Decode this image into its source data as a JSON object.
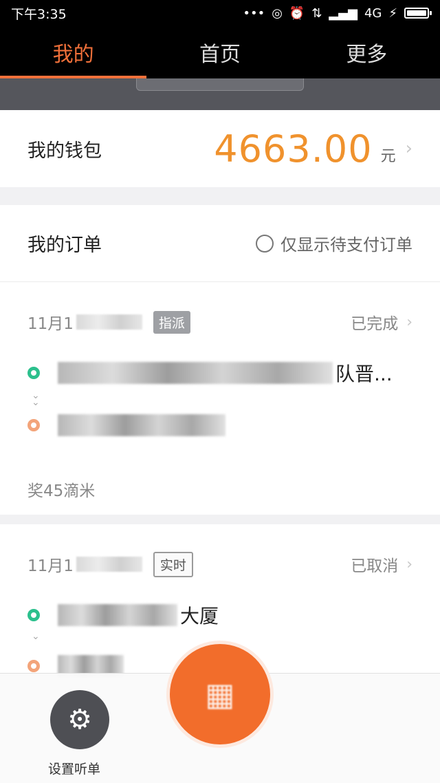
{
  "status_bar": {
    "time": "下午3:35",
    "network": "4G"
  },
  "tabs": [
    {
      "label": "我的",
      "active": true
    },
    {
      "label": "首页",
      "active": false
    },
    {
      "label": "更多",
      "active": false
    }
  ],
  "wallet": {
    "label": "我的钱包",
    "amount": "4663.00",
    "unit": "元"
  },
  "orders": {
    "title": "我的订单",
    "filter_label": "仅显示待支付订单",
    "items": [
      {
        "date_prefix": "11月1",
        "tag": "指派",
        "status": "已完成",
        "start_tail": "队晋...",
        "reward": "奖45滴米"
      },
      {
        "date_prefix": "11月1",
        "tag": "实时",
        "status": "已取消",
        "start_tail": "大厦"
      }
    ]
  },
  "bottom": {
    "settings_label": "设置听单"
  },
  "colors": {
    "accent": "#f0703a",
    "amount": "#f0922d",
    "start_dot": "#2cc08d",
    "end_dot": "#f3a47a"
  }
}
